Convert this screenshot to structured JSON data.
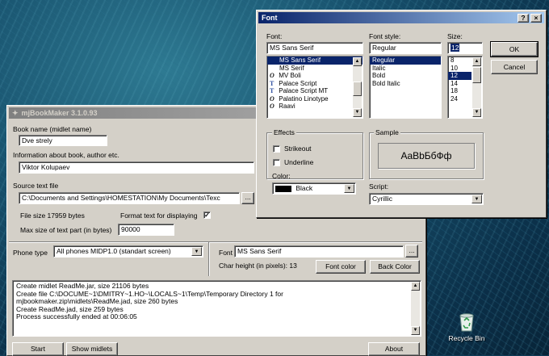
{
  "desktop": {
    "recycle_bin_label": "Recycle Bin"
  },
  "main_window": {
    "title": "mjBookMaker 3.1.0.93",
    "book_name_label": "Book name (midlet name)",
    "book_name_value": "Dve strely",
    "book_info_label": "Information about book, author etc.",
    "book_info_value": "Viktor Kolupaev",
    "source_label": "Source text file",
    "source_value": "C:\\Documents and Settings\\HOMESTATION\\My Documents\\Texc",
    "browse_label": "...",
    "file_size_text": "File size 17959 bytes",
    "format_text_label": "Format text for displaying",
    "format_text_checked": "✓",
    "max_size_label": "Max size of text part (in bytes)",
    "max_size_value": "90000",
    "phone_type_label": "Phone type",
    "phone_type_value": "All phones  MIDP1.0 (standart screen)",
    "font_label": "Font",
    "font_value": "MS Sans Serif",
    "font_browse_label": "...",
    "char_height_text": "Char height (in pixels): 13",
    "font_color_button": "Font color",
    "back_color_button": "Back Color",
    "log_lines": [
      "Create midlet ReadMe.jar, size 21106 bytes",
      "Create file C:\\DOCUME~1\\DMITRY~1.HO~\\LOCALS~1\\Temp\\Temporary Directory 1 for",
      "mjbookmaker.zip\\midlets\\ReadMe.jad, size 260 bytes",
      "Create ReadMe.jad, size 259 bytes",
      "Process successfully ended at 00:06:05"
    ],
    "start_button": "Start",
    "show_midlets_button": "Show midlets",
    "about_button": "About"
  },
  "font_dialog": {
    "title": "Font",
    "help_glyph": "?",
    "close_glyph": "×",
    "font_label": "Font:",
    "font_value": "MS Sans Serif",
    "font_list": [
      {
        "name": "MS Sans Serif",
        "icon": ""
      },
      {
        "name": "MS Serif",
        "icon": ""
      },
      {
        "name": "MV Boli",
        "icon": "O"
      },
      {
        "name": "Palace Script",
        "icon": "T"
      },
      {
        "name": "Palace Script MT",
        "icon": "T"
      },
      {
        "name": "Palatino Linotype",
        "icon": "O"
      },
      {
        "name": "Raavi",
        "icon": "O"
      }
    ],
    "style_label": "Font style:",
    "style_value": "Regular",
    "style_list": [
      "Regular",
      "Italic",
      "Bold",
      "Bold Italic"
    ],
    "size_label": "Size:",
    "size_value": "12",
    "size_list": [
      "8",
      "10",
      "12",
      "14",
      "18",
      "24"
    ],
    "ok_button": "OK",
    "cancel_button": "Cancel",
    "effects_label": "Effects",
    "strikeout_label": "Strikeout",
    "underline_label": "Underline",
    "color_label": "Color:",
    "color_value": "Black",
    "color_swatch": "#000000",
    "sample_label": "Sample",
    "sample_text": "AaBbБбФф",
    "script_label": "Script:",
    "script_value": "Cyrillic"
  },
  "colors": {
    "active_title": "#0a246a",
    "inactive_title": "#808080",
    "selection": "#0a246a",
    "face": "#d4d0c8"
  }
}
